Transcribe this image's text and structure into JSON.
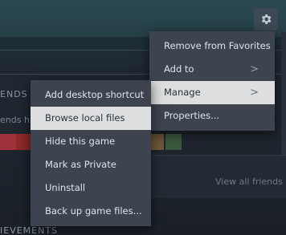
{
  "background": {
    "section_friends": "ENDS W",
    "friends_sub": "ends h",
    "view_all_friends": "View all friends w",
    "section_achievements": "IEVEMENTS"
  },
  "icons": {
    "settings": "gear-icon",
    "submenu": "chevron-right-icon"
  },
  "main_menu": {
    "items": [
      {
        "label": "Remove from Favorites"
      },
      {
        "label": "Add to",
        "chevron": ">"
      },
      {
        "label": "Manage",
        "chevron": ">"
      },
      {
        "label": "Properties..."
      }
    ]
  },
  "manage_submenu": {
    "items": [
      {
        "label": "Add desktop shortcut"
      },
      {
        "label": "Browse local files"
      },
      {
        "label": "Hide this game"
      },
      {
        "label": "Mark as Private"
      },
      {
        "label": "Uninstall"
      },
      {
        "label": "Back up game files..."
      }
    ]
  },
  "colors": {
    "menu_bg": "#3d4450",
    "highlight_bg": "#dcdedf",
    "menu_text": "#dfe3e8"
  }
}
